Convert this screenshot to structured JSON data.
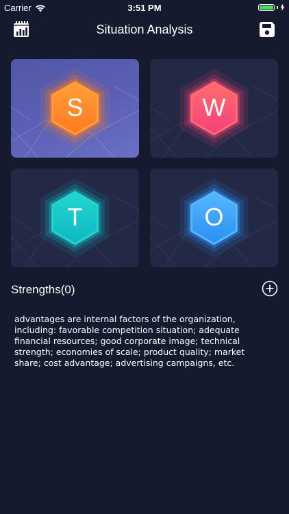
{
  "status_bar": {
    "carrier": "Carrier",
    "time": "3:51 PM",
    "battery_level": 1.0,
    "battery_color": "#4cd964"
  },
  "nav": {
    "title": "Situation Analysis",
    "left_icon": "calendar-chart-icon",
    "right_icon": "save-icon"
  },
  "tiles": [
    {
      "letter": "S",
      "color_top": "#ff9f3a",
      "color_bottom": "#ff7a1f",
      "selected": true
    },
    {
      "letter": "W",
      "color_top": "#ff6d6d",
      "color_bottom": "#f5407a",
      "selected": false
    },
    {
      "letter": "T",
      "color_top": "#22d6cf",
      "color_bottom": "#10b8c2",
      "selected": false
    },
    {
      "letter": "O",
      "color_top": "#55b8ff",
      "color_bottom": "#2a8ff2",
      "selected": false
    }
  ],
  "section": {
    "title": "Strengths(0)",
    "add_icon": "plus-circle-icon"
  },
  "description": "advantages are internal factors of the organization, including: favorable competition situation; adequate financial resources; good corporate image; technical strength; economies of scale; product quality; market share; cost advantage; advertising campaigns, etc.",
  "colors": {
    "background": "#151a2e",
    "tile": "#232844",
    "tile_selected": "#5a5fb3"
  }
}
